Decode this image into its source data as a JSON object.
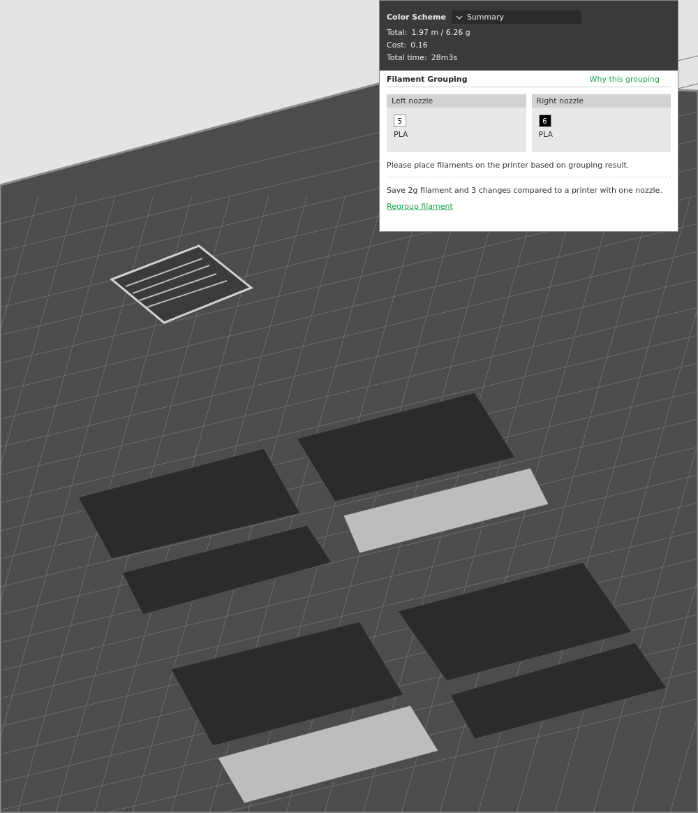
{
  "slicing_result": {
    "color_scheme": {
      "label": "Color Scheme",
      "value": "Summary"
    },
    "stats": [
      {
        "label": "Total:",
        "value": "1.97 m / 6.26 g"
      },
      {
        "label": "Cost:",
        "value": "0.16"
      },
      {
        "label": "Total time:",
        "value": "28m3s"
      }
    ]
  },
  "filament_grouping": {
    "title": "Filament Grouping",
    "help_link": "Why this grouping",
    "nozzles": [
      {
        "label": "Left nozzle",
        "filaments": [
          {
            "number": "5",
            "color": "#ffffff",
            "material": "PLA"
          }
        ]
      },
      {
        "label": "Right nozzle",
        "filaments": [
          {
            "number": "6",
            "color": "#000000",
            "material": "PLA"
          }
        ]
      }
    ],
    "hint": "Please place filaments on the printer based on grouping result.",
    "saving": "Save 2g filament and 3 changes compared to a printer with one nozzle.",
    "regroup_link": "Regroup filament"
  }
}
